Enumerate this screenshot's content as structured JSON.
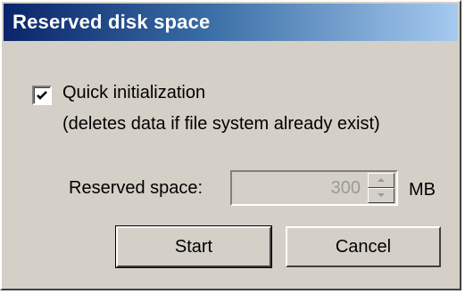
{
  "window": {
    "title": "Reserved disk space"
  },
  "quick_init": {
    "label": "Quick initialization",
    "checked": true,
    "note": "(deletes data if file system already exist)"
  },
  "reserved_space": {
    "label": "Reserved space:",
    "value": "300",
    "unit": "MB",
    "enabled": false
  },
  "buttons": {
    "start": "Start",
    "cancel": "Cancel"
  },
  "icons": {
    "check": "checkmark-icon",
    "spin_up": "arrow-up-icon",
    "spin_down": "arrow-down-icon"
  },
  "colors": {
    "face": "#d4d0c8",
    "title_start": "#0a246a",
    "title_end": "#a6caf0",
    "disabled_text": "#9a9a9a"
  }
}
